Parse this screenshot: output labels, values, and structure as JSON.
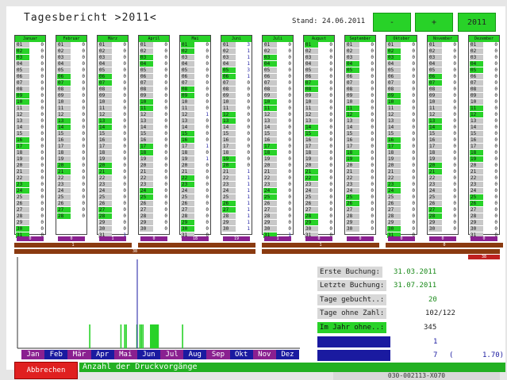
{
  "header": {
    "title": "Tagesbericht >2011<",
    "stand": "Stand: 24.06.2011",
    "btn_minus": "-",
    "btn_plus": "+",
    "btn_year": "2011"
  },
  "months": [
    {
      "name": "Januar",
      "values": [
        "0",
        "0",
        "0",
        "0",
        "0",
        "0",
        "0",
        "0",
        "0",
        "0",
        "0",
        "0",
        "0",
        "0",
        "0",
        "0",
        "0",
        "0",
        "0",
        "0",
        "0",
        "0",
        "0",
        "0",
        "0",
        "0",
        "0",
        "0",
        "0",
        "0",
        "0"
      ]
    },
    {
      "name": "Februar",
      "values": [
        "0",
        "0",
        "0",
        "0",
        "0",
        "0",
        "0",
        "0",
        "0",
        "0",
        "0",
        "0",
        "0",
        "0",
        "0",
        "0",
        "0",
        "0",
        "0",
        "0",
        "0",
        "0",
        "0",
        "0",
        "0",
        "0",
        "0",
        "0"
      ]
    },
    {
      "name": "März",
      "values": [
        "0",
        "0",
        "0",
        "0",
        "0",
        "0",
        "0",
        "0",
        "0",
        "0",
        "0",
        "0",
        "0",
        "0",
        "0",
        "0",
        "0",
        "0",
        "0",
        "0",
        "0",
        "0",
        "0",
        "0",
        "0",
        "0",
        "0",
        "0",
        "0",
        "0",
        "1"
      ]
    },
    {
      "name": "April",
      "values": [
        "0",
        "0",
        "0",
        "0",
        "0",
        "0",
        "0",
        "0",
        "0",
        "0",
        "0",
        "0",
        "0",
        "0",
        "0",
        "0",
        "0",
        "0",
        "0",
        "0",
        "0",
        "0",
        "0",
        "0",
        "0",
        "0",
        "0",
        "0",
        "0",
        "0"
      ]
    },
    {
      "name": "Mai",
      "values": [
        "0",
        "0",
        "0",
        "0",
        "0",
        "0",
        "0",
        "0",
        "0",
        "0",
        "0",
        "1",
        "0",
        "0",
        "0",
        "0",
        "1",
        "0",
        "1",
        "0",
        "0",
        "0",
        "0",
        "0",
        "0",
        "0",
        "0",
        "0",
        "0",
        "0",
        "0"
      ]
    },
    {
      "name": "Juni",
      "values": [
        "3",
        "1",
        "1",
        "1",
        "3",
        "1",
        "0",
        "0",
        "0",
        "0",
        "0",
        "0",
        "0",
        "0",
        "0",
        "0",
        "0",
        "0",
        "0",
        "0",
        "1",
        "1",
        "1",
        "1",
        "1",
        "1",
        "1",
        "1",
        "1",
        "1"
      ]
    },
    {
      "name": "Juli",
      "values": [
        "0",
        "0",
        "0",
        "0",
        "0",
        "0",
        "0",
        "0",
        "0",
        "0",
        "0",
        "0",
        "0",
        "0",
        "0",
        "0",
        "0",
        "0",
        "0",
        "0",
        "0",
        "0",
        "0",
        "0",
        "0",
        "0",
        "0",
        "0",
        "0",
        "0",
        "1"
      ]
    },
    {
      "name": "August",
      "values": [
        "0",
        "0",
        "0",
        "0",
        "0",
        "0",
        "0",
        "0",
        "0",
        "0",
        "0",
        "0",
        "0",
        "0",
        "0",
        "0",
        "0",
        "0",
        "0",
        "0",
        "0",
        "0",
        "0",
        "0",
        "0",
        "0",
        "0",
        "0",
        "0",
        "0",
        "0"
      ]
    },
    {
      "name": "September",
      "values": [
        "0",
        "0",
        "0",
        "0",
        "0",
        "0",
        "0",
        "0",
        "0",
        "0",
        "0",
        "0",
        "0",
        "0",
        "0",
        "0",
        "0",
        "0",
        "0",
        "0",
        "0",
        "0",
        "0",
        "0",
        "0",
        "0",
        "0",
        "0",
        "0",
        "0"
      ]
    },
    {
      "name": "Oktober",
      "values": [
        "0",
        "0",
        "0",
        "0",
        "0",
        "0",
        "0",
        "0",
        "0",
        "0",
        "0",
        "0",
        "0",
        "0",
        "0",
        "0",
        "0",
        "0",
        "0",
        "0",
        "0",
        "0",
        "0",
        "0",
        "0",
        "0",
        "0",
        "0",
        "0",
        "0",
        "0"
      ]
    },
    {
      "name": "November",
      "values": [
        "0",
        "0",
        "0",
        "0",
        "0",
        "0",
        "0",
        "0",
        "0",
        "0",
        "0",
        "0",
        "0",
        "0",
        "0",
        "0",
        "0",
        "0",
        "0",
        "0",
        "0",
        "0",
        "0",
        "0",
        "0",
        "0",
        "0",
        "0",
        "0",
        "0"
      ]
    },
    {
      "name": "Dezember",
      "values": [
        "0",
        "0",
        "0",
        "0",
        "0",
        "0",
        "0",
        "0",
        "0",
        "0",
        "0",
        "0",
        "0",
        "0",
        "0",
        "0",
        "0",
        "0",
        "0",
        "0",
        "0",
        "0",
        "0",
        "0",
        "0",
        "0",
        "0",
        "0",
        "0",
        "0",
        "0"
      ]
    }
  ],
  "month_totals": [
    "0",
    "0",
    "1",
    "0",
    "18",
    "19",
    "1",
    "0",
    "0",
    "0",
    "0",
    "0"
  ],
  "quarter_totals": [
    "1",
    "",
    "1",
    "0"
  ],
  "half_totals": [
    "38",
    ""
  ],
  "year_total": "38",
  "chart_data": {
    "type": "bar",
    "months": [
      "Jan",
      "Feb",
      "Mär",
      "Apr",
      "Mai",
      "Jun",
      "Jul",
      "Aug",
      "Sep",
      "Okt",
      "Nov",
      "Dez"
    ],
    "month_colors": [
      "#8a2090",
      "#1a1aa0",
      "#8a2090",
      "#1a1aa0",
      "#8a2090",
      "#1a1aa0",
      "#8a2090",
      "#1a1aa0",
      "#8a2090",
      "#1a1aa0",
      "#8a2090",
      "#1a1aa0"
    ],
    "highlight_days": [
      90,
      131,
      136,
      138,
      152,
      156,
      158,
      160,
      170,
      171,
      172,
      173,
      174,
      175,
      176,
      177,
      178,
      179,
      180,
      212
    ]
  },
  "stats": {
    "erste_label": "Erste  Buchung:",
    "erste_value": "31.03.2011",
    "letzte_label": "Letzte Buchung:",
    "letzte_value": "31.07.2011",
    "gebucht_label": "Tage gebucht..:",
    "gebucht_value": "20",
    "ohne_zahl_label": "Tage ohne Zahl:",
    "ohne_zahl_value": "102/122",
    "im_jahr_label": "Im Jahr ohne..:",
    "im_jahr_value": "345",
    "max_value": "1",
    "avg_value": "7",
    "avg_paren": "(",
    "avg_ratio": "1.70)"
  },
  "footer": {
    "cancel": "Abbrechen",
    "status": "Anzahl der Druckvorgänge",
    "code": "030-002113-X070"
  },
  "colors": {
    "accent_green": "#28d228",
    "purple": "#8a2090",
    "brown": "#8a3a10",
    "blue": "#1a1aa0",
    "red": "#e02020"
  }
}
